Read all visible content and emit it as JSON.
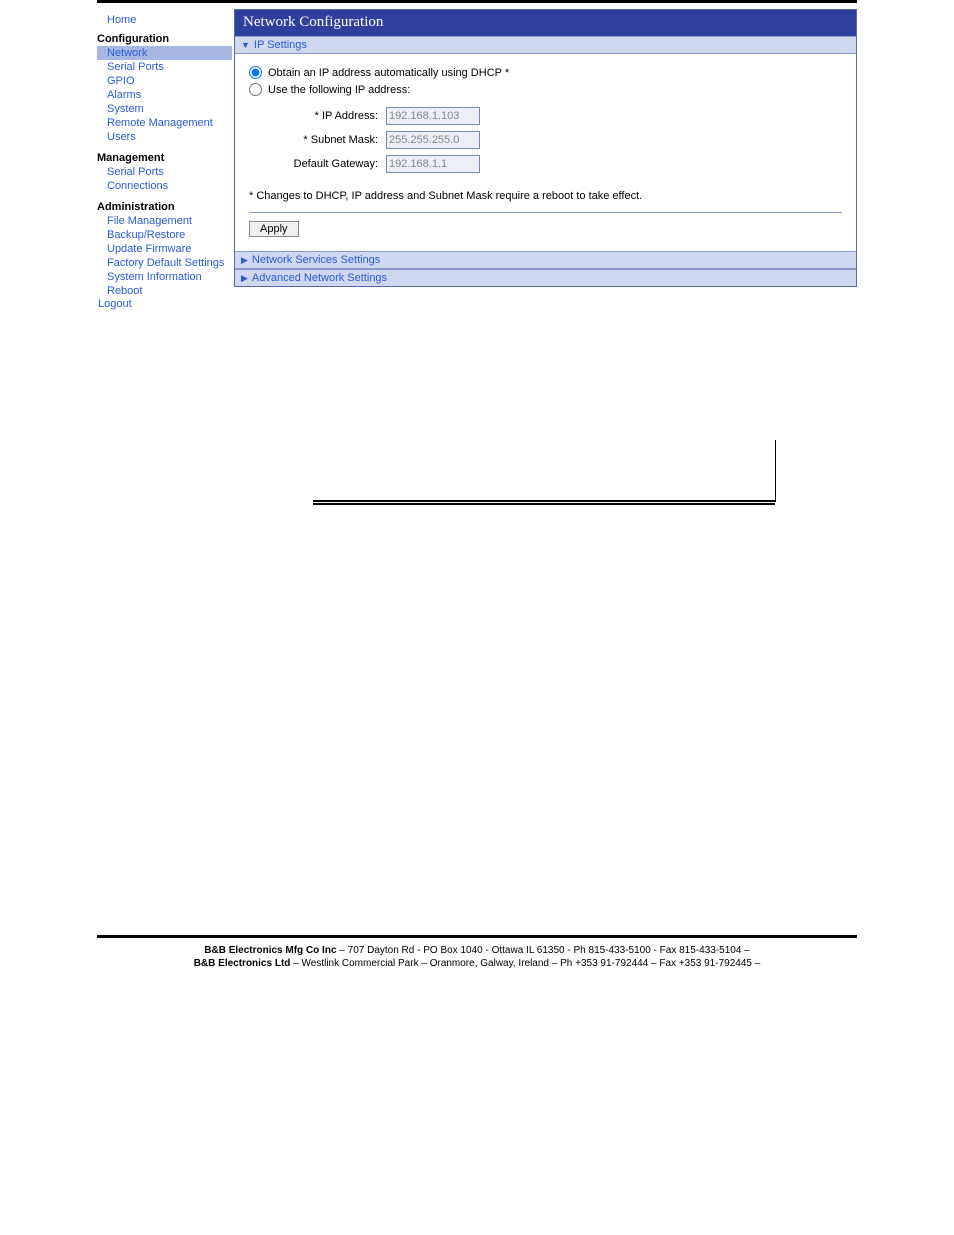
{
  "sidebar": {
    "home": "Home",
    "configuration": {
      "title": "Configuration",
      "items": [
        {
          "label": "Network",
          "selected": true
        },
        {
          "label": "Serial Ports"
        },
        {
          "label": "GPIO"
        },
        {
          "label": "Alarms"
        },
        {
          "label": "System"
        },
        {
          "label": "Remote Management"
        },
        {
          "label": "Users"
        }
      ]
    },
    "management": {
      "title": "Management",
      "items": [
        {
          "label": "Serial Ports"
        },
        {
          "label": "Connections"
        }
      ]
    },
    "administration": {
      "title": "Administration",
      "items": [
        {
          "label": "File Management"
        },
        {
          "label": "Backup/Restore"
        },
        {
          "label": "Update Firmware"
        },
        {
          "label": "Factory Default Settings"
        },
        {
          "label": "System Information"
        },
        {
          "label": "Reboot"
        }
      ]
    },
    "logout": "Logout"
  },
  "main": {
    "title": "Network Configuration",
    "sections": {
      "ip": {
        "label": "IP Settings",
        "expanded": true
      },
      "services": {
        "label": "Network Services Settings",
        "expanded": false
      },
      "advanced": {
        "label": "Advanced Network Settings",
        "expanded": false
      }
    },
    "ipSettings": {
      "dhcpLabel": "Obtain an IP address automatically using DHCP *",
      "staticLabel": "Use the following IP address:",
      "fields": {
        "ip": {
          "label": "* IP Address:",
          "value": "192.168.1.103"
        },
        "mask": {
          "label": "* Subnet Mask:",
          "value": "255.255.255.0"
        },
        "gw": {
          "label": "Default Gateway:",
          "value": "192.168.1.1"
        }
      },
      "note": "* Changes to DHCP, IP address and Subnet Mask require a reboot to take effect.",
      "applyLabel": "Apply"
    }
  },
  "footer": {
    "line1": "B&B Electronics Mfg Co Inc – 707 Dayton Rd - PO Box 1040 - Ottawa IL 61350 - Ph 815-433-5100 - Fax 815-433-5104 –",
    "line2": "B&B Electronics Ltd – Westlink Commercial Park – Oranmore, Galway, Ireland – Ph +353 91-792444 – Fax +353 91-792445 –"
  }
}
